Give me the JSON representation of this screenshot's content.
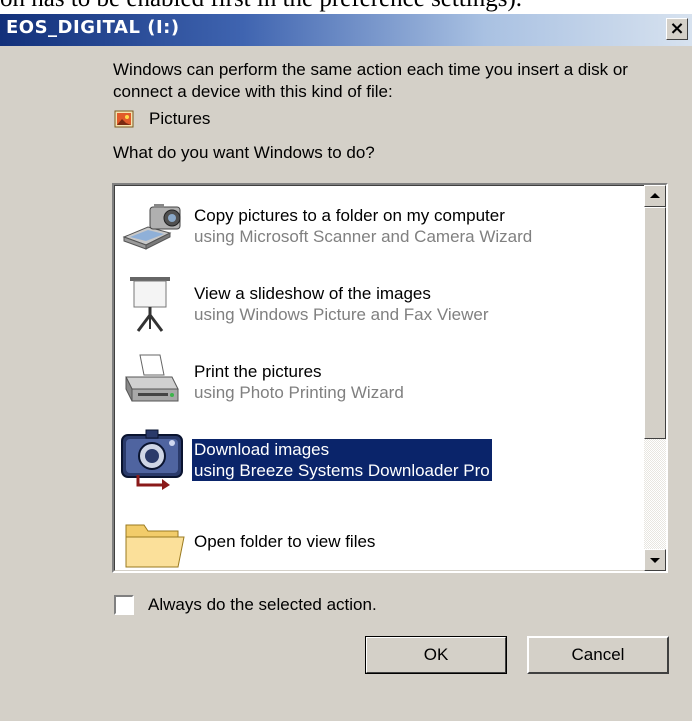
{
  "background_text": "on has to be enabled first in the preference settings).",
  "window": {
    "title": "EOS_DIGITAL (I:)",
    "close_label": "×"
  },
  "description": "Windows can perform the same action each time you insert a disk or connect a device with this kind of file:",
  "content_type": {
    "label": "Pictures",
    "icon": "pictures-icon"
  },
  "question": "What do you want Windows to do?",
  "actions": [
    {
      "title": "Copy pictures to a folder on my computer",
      "subtitle": "using Microsoft Scanner and Camera Wizard",
      "icon": "scanner-camera-icon",
      "selected": false
    },
    {
      "title": "View a slideshow of the images",
      "subtitle": "using Windows Picture and Fax Viewer",
      "icon": "projector-screen-icon",
      "selected": false
    },
    {
      "title": "Print the pictures",
      "subtitle": "using Photo Printing Wizard",
      "icon": "printer-icon",
      "selected": false
    },
    {
      "title": "Download images",
      "subtitle": "using Breeze Systems Downloader Pro",
      "icon": "download-camera-icon",
      "selected": true
    },
    {
      "title": "Open folder to view files",
      "subtitle": "",
      "icon": "folder-icon",
      "selected": false
    }
  ],
  "always_checkbox": {
    "label": "Always do the selected action.",
    "checked": false
  },
  "buttons": {
    "ok": "OK",
    "cancel": "Cancel"
  },
  "colors": {
    "selection": "#0a246a",
    "dialog_face": "#d4d0c8",
    "title_start": "#12307a"
  }
}
